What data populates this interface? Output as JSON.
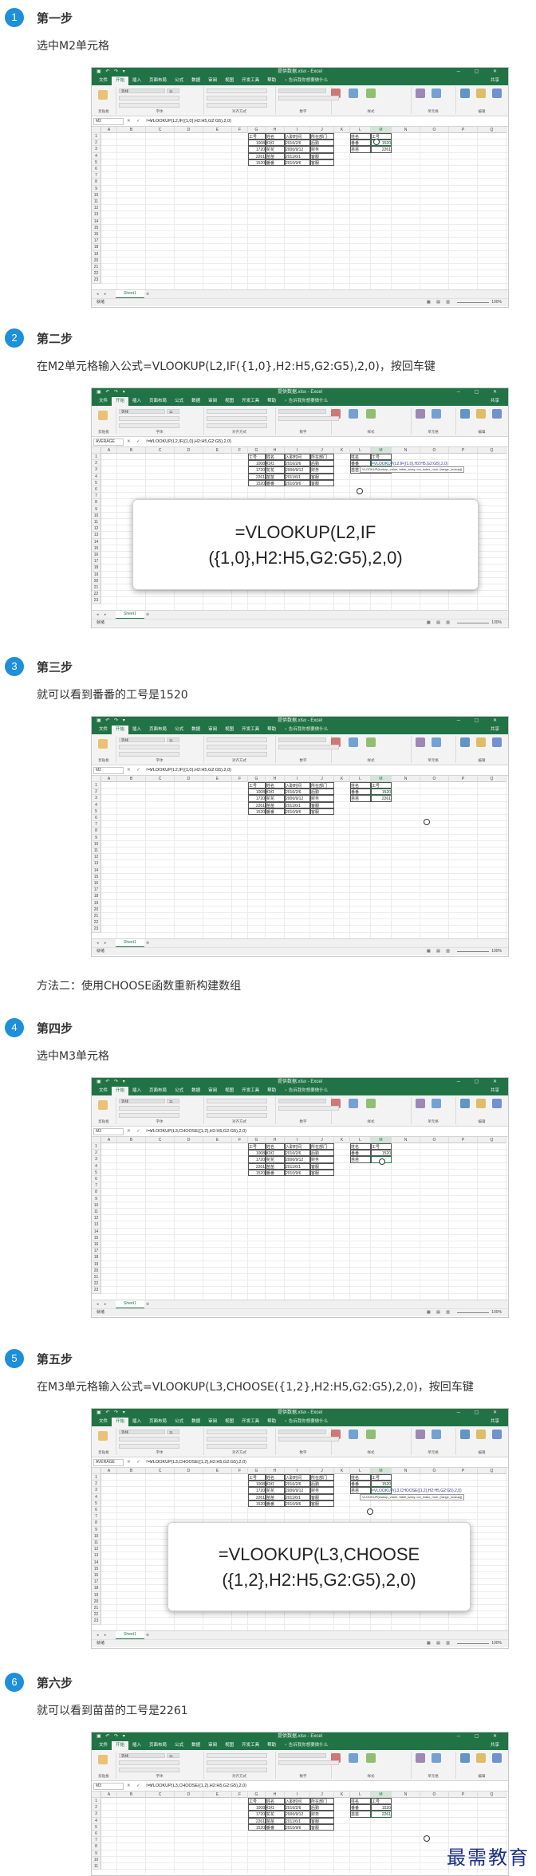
{
  "steps": [
    {
      "num": "1",
      "title": "第一步",
      "desc": "选中M2单元格",
      "excel": {
        "namebox": "M2",
        "formula": "=VLOOKUP(L2,IF({1,0},H2:H5,G2:G5),2,0)",
        "active_cell": "M2"
      }
    },
    {
      "num": "2",
      "title": "第二步",
      "desc": "在M2单元格输入公式=VLOOKUP(L2,IF({1,0},H2:H5,G2:G5),2,0)，按回车键",
      "excel": {
        "namebox": "AVERAGE",
        "formula": "=VLOOKUP(L2,IF({1,0},H2:H5,G2:G5),2,0)",
        "edit_text": "=VLOOKUP(L2,IF({1,0},H2:H5,G2:G5),2,0)",
        "tooltip": "VLOOKUP(lookup_value, table_array, col_index_num, [range_lookup])"
      },
      "callout": "=VLOOKUP(L2,IF\n({1,0},H2:H5,G2:G5),2,0)"
    },
    {
      "num": "3",
      "title": "第三步",
      "desc": "就可以看到番番的工号是1520",
      "excel": {
        "namebox": "M2",
        "formula": "=VLOOKUP(L2,IF({1,0},H2:H5,G2:G5),2,0)"
      }
    },
    {
      "num": "4",
      "title": "第四步",
      "desc": "选中M3单元格",
      "excel": {
        "namebox": "M3",
        "formula": "=VLOOKUP(L3,CHOOSE({1,2},H2:H5,G2:G5),2,0)"
      }
    },
    {
      "num": "5",
      "title": "第五步",
      "desc": "在M3单元格输入公式=VLOOKUP(L3,CHOOSE({1,2},H2:H5,G2:G5),2,0)，按回车键",
      "excel": {
        "namebox": "AVERAGE",
        "formula": "=VLOOKUP(L3,CHOOSE({1,2},H2:H5,G2:G5),2,0)",
        "edit_text": "=VLOOKUP(L3,CHOOSE({1,2},H2:H5,G2:G5),2,0)",
        "tooltip": "VLOOKUP(lookup_value, table_array, col_index_num, [range_lookup])"
      },
      "callout": "=VLOOKUP(L3,CHOOSE\n({1,2},H2:H5,G2:G5),2,0)"
    },
    {
      "num": "6",
      "title": "第六步",
      "desc": "就可以看到苗苗的工号是2261",
      "excel": {
        "namebox": "M3",
        "formula": "=VLOOKUP(L3,CHOOSE({1,2},H2:H5,G2:G5),2,0)"
      }
    }
  ],
  "method_two_note": "方法二：使用CHOOSE函数重新构建数组",
  "excel_common": {
    "window_title": "提供数据.xlsx - Excel",
    "ribbon_tabs": [
      "文件",
      "开始",
      "插入",
      "页面布局",
      "公式",
      "数据",
      "审阅",
      "视图",
      "开发工具",
      "帮助"
    ],
    "tell_me": "告诉我你想要做什么",
    "share": "共享",
    "font_name": "等线",
    "font_size": "11",
    "ribbon_groups": [
      "剪贴板",
      "字体",
      "对齐方式",
      "数字",
      "样式",
      "单元格",
      "编辑"
    ],
    "columns": [
      "A",
      "B",
      "C",
      "D",
      "E",
      "F",
      "G",
      "H",
      "I",
      "J",
      "K",
      "L",
      "M",
      "N",
      "O",
      "P",
      "Q"
    ],
    "row_numbers": [
      "1",
      "2",
      "3",
      "4",
      "5",
      "6",
      "7",
      "8",
      "9",
      "10",
      "11",
      "12",
      "13",
      "14",
      "15",
      "16",
      "17",
      "18",
      "19",
      "20",
      "21",
      "22",
      "23"
    ],
    "table_headers": [
      "工号",
      "姓名",
      "入职时间",
      "所在部门"
    ],
    "table_rows": [
      [
        "1008",
        "红红",
        "2016/2/6",
        "后勤"
      ],
      [
        "1720",
        "花花",
        "2006/9/12",
        "财务"
      ],
      [
        "2261",
        "苗苗",
        "2011/6/1",
        "客服"
      ],
      [
        "1520",
        "番番",
        "2010/9/6",
        "客服"
      ]
    ],
    "lookup_headers": [
      "姓名",
      "工号"
    ],
    "lookup_names": [
      "番番",
      "苗苗"
    ],
    "lookup_results": [
      "1520",
      "2261"
    ],
    "sheet_name": "Sheet1",
    "status_ready": "就绪",
    "zoom": "100%"
  },
  "watermark": "最需教育"
}
